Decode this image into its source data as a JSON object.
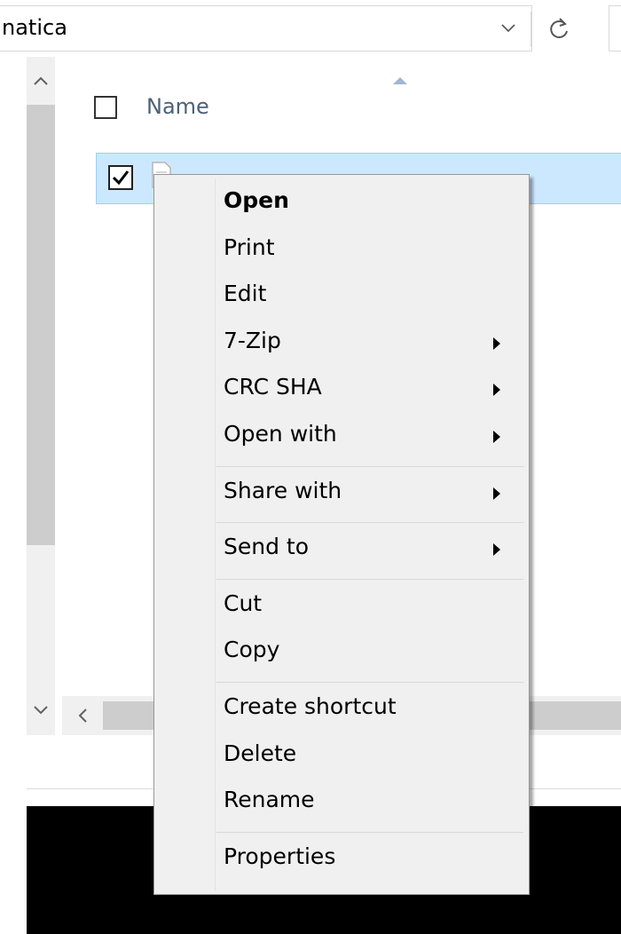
{
  "address_bar": {
    "path_text": "natica"
  },
  "file_list": {
    "header": {
      "name_label": "Name"
    },
    "rows": [
      {
        "name": "",
        "selected": true,
        "checked": true
      }
    ]
  },
  "context_menu": {
    "groups": [
      [
        {
          "label": "Open",
          "bold": true,
          "submenu": false
        },
        {
          "label": "Print",
          "submenu": false
        },
        {
          "label": "Edit",
          "submenu": false
        },
        {
          "label": "7-Zip",
          "submenu": true
        },
        {
          "label": "CRC SHA",
          "submenu": true
        },
        {
          "label": "Open with",
          "submenu": true
        }
      ],
      [
        {
          "label": "Share with",
          "submenu": true
        }
      ],
      [
        {
          "label": "Send to",
          "submenu": true
        }
      ],
      [
        {
          "label": "Cut",
          "submenu": false
        },
        {
          "label": "Copy",
          "submenu": false
        }
      ],
      [
        {
          "label": "Create shortcut",
          "submenu": false
        },
        {
          "label": "Delete",
          "submenu": false
        },
        {
          "label": "Rename",
          "submenu": false
        }
      ],
      [
        {
          "label": "Properties",
          "submenu": false
        }
      ]
    ]
  },
  "colors": {
    "selection_bg": "#cce8ff",
    "selection_border": "#99d1ff",
    "column_header_text": "#4c607a",
    "menu_bg": "#f0f0f0"
  },
  "icons": {
    "dropdown": "chevron-down-icon",
    "refresh": "refresh-icon",
    "sort": "sort-ascending-icon",
    "file": "text-file-icon",
    "submenu": "submenu-arrow-icon"
  }
}
